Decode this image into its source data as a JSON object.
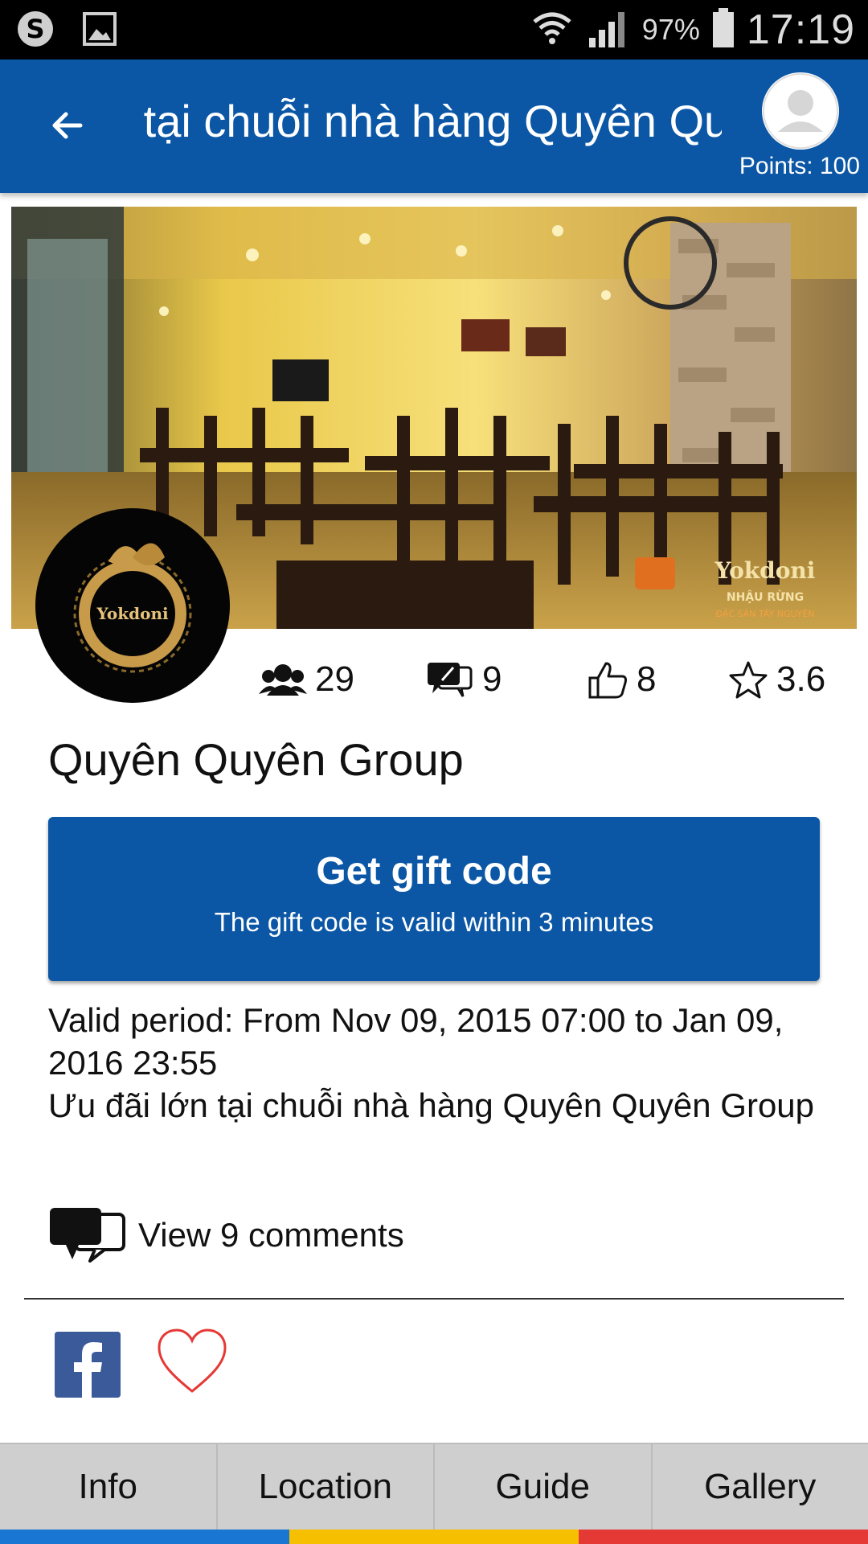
{
  "status_bar": {
    "battery": "97%",
    "time": "17:19",
    "icons": [
      "skype-icon",
      "gallery-icon",
      "wifi-icon",
      "signal-icon",
      "battery-icon"
    ]
  },
  "app_bar": {
    "title": "Ưu đãi lớn tại chuỗi nhà hàng Quyên Quyên Group",
    "points_label": "Points: 100",
    "back_icon": "arrow-left-icon",
    "avatar_icon": "user-avatar-icon"
  },
  "hero": {
    "logo_text": "Yokdoni",
    "image_caption_brand": "Yokdoni",
    "image_caption_line1": "NHẬU RỪNG",
    "image_caption_line2": "ĐẶC SẢN TÂY NGUYÊN"
  },
  "stats": {
    "followers": "29",
    "comments": "9",
    "likes": "8",
    "rating": "3.6"
  },
  "group_name": "Quyên Quyên Group",
  "gift": {
    "title": "Get gift code",
    "subtitle": "The gift code is valid within 3 minutes"
  },
  "description": {
    "valid_period": "Valid period: From Nov 09, 2015 07:00 to Jan 09, 2016 23:55",
    "offer": "Ưu đãi lớn tại chuỗi nhà hàng Quyên Quyên Group"
  },
  "comments_link": "View 9 comments",
  "tabs": [
    {
      "label": "Info"
    },
    {
      "label": "Location"
    },
    {
      "label": "Guide"
    },
    {
      "label": "Gallery"
    }
  ],
  "colors": {
    "brand_blue": "#0b57a6",
    "strip_blue": "#1976d2",
    "strip_yellow": "#f6c000",
    "strip_red": "#e53935",
    "facebook": "#3b5a9a",
    "heart": "#e53935"
  }
}
